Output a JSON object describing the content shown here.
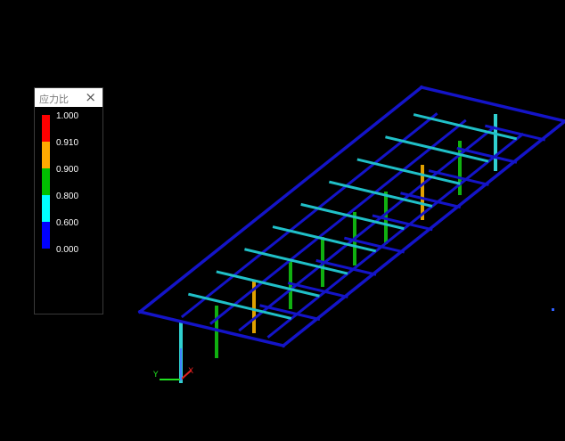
{
  "legend": {
    "title": "应力比",
    "entries": [
      {
        "label": "1.000",
        "color": "#ff0000"
      },
      {
        "label": "0.910",
        "color": "#ffaa00"
      },
      {
        "label": "0.900",
        "color": "#00c000"
      },
      {
        "label": "0.800",
        "color": "#00ffff"
      },
      {
        "label": "0.600",
        "color": "#0000ff"
      },
      {
        "label": "0.000",
        "color": ""
      }
    ]
  },
  "colors": {
    "background": "#000000",
    "beam_low": "#1414c8",
    "beam_mid": "#20c0c8",
    "column_green": "#10b010",
    "column_orange": "#e0a000",
    "column_cyan": "#30d0d0",
    "axis_x": "#e02020",
    "axis_y": "#20e020",
    "axis_z": "#4080ff"
  },
  "axis_icon": {
    "x_label": "X",
    "y_label": "Y"
  }
}
